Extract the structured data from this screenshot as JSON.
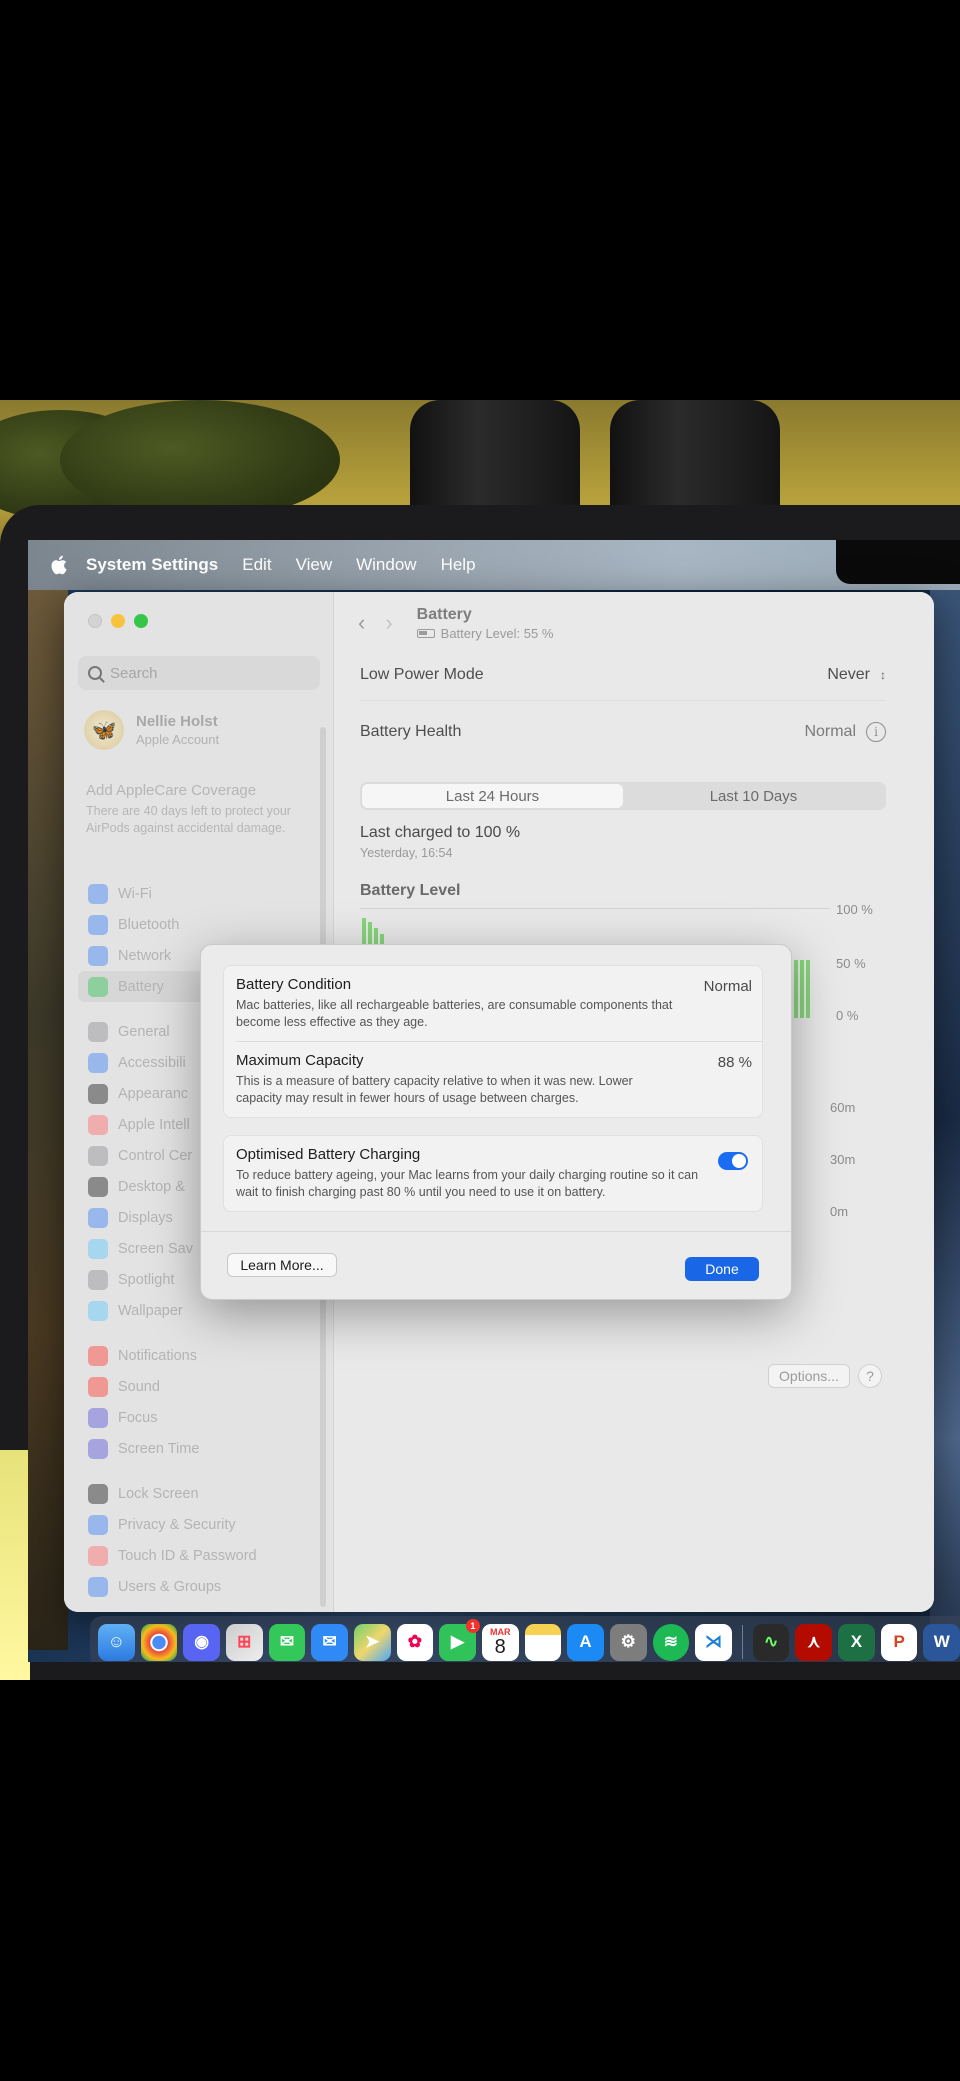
{
  "menubar": {
    "app_name": "System Settings",
    "items": [
      "Edit",
      "View",
      "Window",
      "Help"
    ]
  },
  "sidebar": {
    "search_placeholder": "Search",
    "account": {
      "name": "Nellie Holst",
      "subtitle": "Apple Account"
    },
    "applecare": {
      "title": "Add AppleCare Coverage",
      "body": "There are 40 days left to protect your AirPods against accidental damage."
    },
    "groups": [
      [
        {
          "label": "Wi-Fi",
          "icon": "wifi-icon",
          "color": "#3b82f6"
        },
        {
          "label": "Bluetooth",
          "icon": "bluetooth-icon",
          "color": "#3b82f6"
        },
        {
          "label": "Network",
          "icon": "globe-icon",
          "color": "#3b82f6"
        },
        {
          "label": "Battery",
          "icon": "battery-icon",
          "color": "#34c759",
          "selected": true
        }
      ],
      [
        {
          "label": "General",
          "icon": "gear-icon",
          "color": "#8e8e93"
        },
        {
          "label": "Accessibili",
          "icon": "accessibility-icon",
          "color": "#3b82f6"
        },
        {
          "label": "Appearanc",
          "icon": "appearance-icon",
          "color": "#1d1d1f"
        },
        {
          "label": "Apple Intell",
          "icon": "apple-intelligence-icon",
          "color": "#ff6b6b"
        },
        {
          "label": "Control Cer",
          "icon": "control-centre-icon",
          "color": "#8e8e93"
        },
        {
          "label": "Desktop &",
          "icon": "desktop-dock-icon",
          "color": "#1d1d1f"
        },
        {
          "label": "Displays",
          "icon": "displays-icon",
          "color": "#3b82f6"
        },
        {
          "label": "Screen Sav",
          "icon": "screensaver-icon",
          "color": "#5ac8fa"
        },
        {
          "label": "Spotlight",
          "icon": "spotlight-icon",
          "color": "#8e8e93"
        },
        {
          "label": "Wallpaper",
          "icon": "wallpaper-icon",
          "color": "#5ac8fa"
        }
      ],
      [
        {
          "label": "Notifications",
          "icon": "notifications-icon",
          "color": "#ff3b30"
        },
        {
          "label": "Sound",
          "icon": "sound-icon",
          "color": "#ff3b30"
        },
        {
          "label": "Focus",
          "icon": "focus-icon",
          "color": "#5856d6"
        },
        {
          "label": "Screen Time",
          "icon": "screen-time-icon",
          "color": "#5856d6"
        }
      ],
      [
        {
          "label": "Lock Screen",
          "icon": "lock-icon",
          "color": "#1d1d1f"
        },
        {
          "label": "Privacy & Security",
          "icon": "hand-icon",
          "color": "#3b82f6"
        },
        {
          "label": "Touch ID & Password",
          "icon": "fingerprint-icon",
          "color": "#ff6b6b"
        },
        {
          "label": "Users & Groups",
          "icon": "users-icon",
          "color": "#3b82f6"
        }
      ]
    ]
  },
  "content": {
    "title": "Battery",
    "subtitle": "Battery Level: 55 %",
    "low_power": {
      "label": "Low Power Mode",
      "value": "Never"
    },
    "health": {
      "label": "Battery Health",
      "value": "Normal"
    },
    "tabs": [
      "Last 24 Hours",
      "Last 10 Days"
    ],
    "last_charged": "Last charged to 100 %",
    "last_charged_time": "Yesterday, 16:54",
    "chart_title": "Battery Level",
    "level_ticks": [
      "100 %",
      "50 %",
      "0 %"
    ],
    "usage_ticks": [
      "60m",
      "30m",
      "0m"
    ],
    "options_label": "Options...",
    "help_label": "?"
  },
  "sheet": {
    "condition": {
      "title": "Battery Condition",
      "value": "Normal",
      "desc": "Mac batteries, like all rechargeable batteries, are consumable components that become less effective as they age."
    },
    "capacity": {
      "title": "Maximum Capacity",
      "value": "88 %",
      "desc": "This is a measure of battery capacity relative to when it was new. Lower capacity may result in fewer hours of usage between charges."
    },
    "optimised": {
      "title": "Optimised Battery Charging",
      "desc": "To reduce battery ageing, your Mac learns from your daily charging routine so it can wait to finish charging past 80 % until you need to use it on battery.",
      "enabled": true
    },
    "learn_more": "Learn More...",
    "done": "Done"
  },
  "dock": {
    "calendar_month": "MAR",
    "calendar_day": "8",
    "facetime_badge": "1"
  }
}
